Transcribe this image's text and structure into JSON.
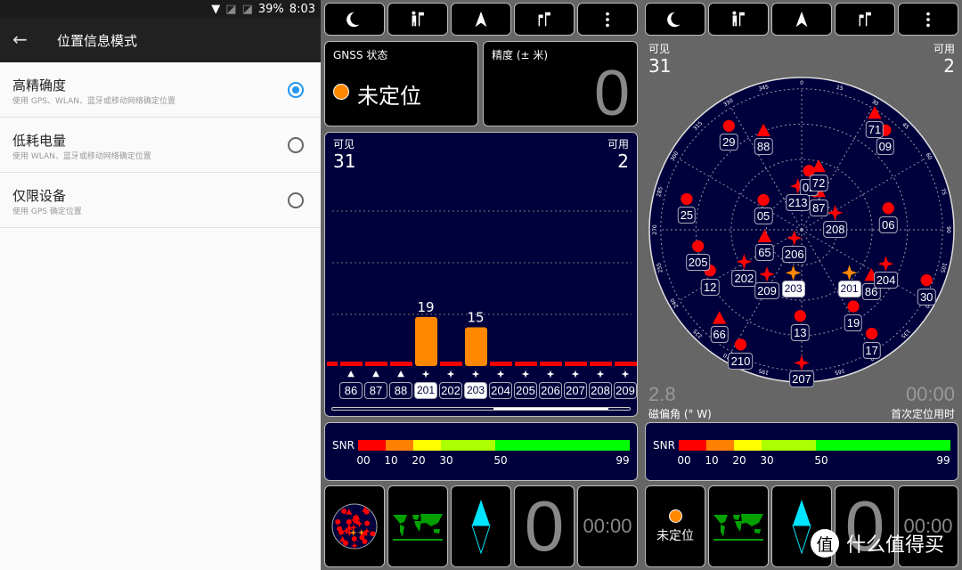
{
  "status_bar": {
    "battery": "39%",
    "time": "8:03"
  },
  "settings": {
    "title": "位置信息模式",
    "back": "←",
    "options": [
      {
        "title": "高精确度",
        "subtitle": "使用 GPS、WLAN、蓝牙或移动网络确定位置",
        "selected": true
      },
      {
        "title": "低耗电量",
        "subtitle": "使用 WLAN、蓝牙或移动网络确定位置",
        "selected": false
      },
      {
        "title": "仅限设备",
        "subtitle": "使用 GPS 确定位置",
        "selected": false
      }
    ]
  },
  "toolbar": {
    "icons": [
      "moon-icon",
      "person-flag-icon",
      "navigation-arrow-icon",
      "flags-icon",
      "more-vert-icon"
    ]
  },
  "gnss": {
    "label": "GNSS 状态",
    "status": "未定位",
    "status_color": "#ff8800"
  },
  "accuracy": {
    "label": "精度 (± 米)",
    "value": "0"
  },
  "counts": {
    "visible_label": "可见",
    "visible": "31",
    "used_label": "可用",
    "used": "2"
  },
  "signal_bars": [
    {
      "id": "86",
      "type": "triangle",
      "snr": 0,
      "used": false
    },
    {
      "id": "87",
      "type": "triangle",
      "snr": 0,
      "used": false
    },
    {
      "id": "88",
      "type": "triangle",
      "snr": 0,
      "used": false
    },
    {
      "id": "201",
      "type": "star",
      "snr": 19,
      "used": true
    },
    {
      "id": "202",
      "type": "star",
      "snr": 0,
      "used": false
    },
    {
      "id": "203",
      "type": "star",
      "snr": 15,
      "used": true
    },
    {
      "id": "204",
      "type": "star",
      "snr": 0,
      "used": false
    },
    {
      "id": "205",
      "type": "star",
      "snr": 0,
      "used": false
    },
    {
      "id": "206",
      "type": "star",
      "snr": 0,
      "used": false
    },
    {
      "id": "207",
      "type": "star",
      "snr": 0,
      "used": false
    },
    {
      "id": "208",
      "type": "star",
      "snr": 0,
      "used": false
    },
    {
      "id": "209",
      "type": "star",
      "snr": 0,
      "used": false
    }
  ],
  "snr_scale": {
    "label": "SNR",
    "ticks": [
      "00",
      "10",
      "20",
      "30",
      "50",
      "99"
    ],
    "colors": [
      "#ff0000",
      "#ff8000",
      "#ffff00",
      "#aaff00",
      "#00ff00"
    ]
  },
  "skyplot": {
    "azimuth_labels": [
      "0",
      "15",
      "30",
      "45",
      "60",
      "75",
      "90",
      "105",
      "120",
      "135",
      "150",
      "165",
      "180",
      "195",
      "210",
      "225",
      "240",
      "255",
      "270",
      "285",
      "300",
      "315",
      "330",
      "345"
    ],
    "satellites": [
      {
        "id": "29",
        "type": "circle",
        "az": 325,
        "el": 9
      },
      {
        "id": "88",
        "type": "triangle",
        "az": 339,
        "el": 22
      },
      {
        "id": "71",
        "type": "triangle",
        "az": 32,
        "el": 2
      },
      {
        "id": "09",
        "type": "circle",
        "az": 40,
        "el": 7
      },
      {
        "id": "02",
        "type": "circle",
        "az": 7,
        "el": 52
      },
      {
        "id": "72",
        "type": "triangle",
        "az": 15,
        "el": 48
      },
      {
        "id": "213",
        "type": "star",
        "az": 355,
        "el": 62
      },
      {
        "id": "87",
        "type": "triangle",
        "az": 24,
        "el": 63
      },
      {
        "id": "208",
        "type": "star",
        "az": 63,
        "el": 66
      },
      {
        "id": "25",
        "type": "circle",
        "az": 285,
        "el": 14
      },
      {
        "id": "05",
        "type": "circle",
        "az": 308,
        "el": 59
      },
      {
        "id": "06",
        "type": "circle",
        "az": 76,
        "el": 33
      },
      {
        "id": "65",
        "type": "triangle",
        "az": 260,
        "el": 66
      },
      {
        "id": "206",
        "type": "star",
        "az": 222,
        "el": 83
      },
      {
        "id": "205",
        "type": "circle",
        "az": 261,
        "el": 23
      },
      {
        "id": "12",
        "type": "circle",
        "az": 246,
        "el": 26
      },
      {
        "id": "202",
        "type": "star",
        "az": 241,
        "el": 48
      },
      {
        "id": "209",
        "type": "star",
        "az": 218,
        "el": 54
      },
      {
        "id": "203",
        "type": "star",
        "az": 191,
        "el": 62,
        "used": true
      },
      {
        "id": "201",
        "type": "star",
        "az": 132,
        "el": 49,
        "used": true
      },
      {
        "id": "86",
        "type": "triangle",
        "az": 123,
        "el": 37
      },
      {
        "id": "204",
        "type": "star",
        "az": 112,
        "el": 32
      },
      {
        "id": "30",
        "type": "circle",
        "az": 112,
        "el": 4
      },
      {
        "id": "19",
        "type": "circle",
        "az": 146,
        "el": 31
      },
      {
        "id": "13",
        "type": "circle",
        "az": 181,
        "el": 35
      },
      {
        "id": "66",
        "type": "triangle",
        "az": 223,
        "el": 13
      },
      {
        "id": "17",
        "type": "circle",
        "az": 146,
        "el": 10
      },
      {
        "id": "210",
        "type": "circle",
        "az": 208,
        "el": 7
      },
      {
        "id": "207",
        "type": "star",
        "az": 180,
        "el": 5
      }
    ]
  },
  "declination": {
    "value": "2.8",
    "label": "磁偏角 (° W)"
  },
  "ttff": {
    "value": "00:00",
    "label": "首次定位用时"
  },
  "tiles": {
    "zero": "0",
    "time": "00:00",
    "status": "未定位"
  },
  "watermark": {
    "logo": "值",
    "text": "什么值得买"
  },
  "colors": {
    "navy": "#00003c",
    "unused": "#ff0000",
    "used": "#ff8800"
  }
}
